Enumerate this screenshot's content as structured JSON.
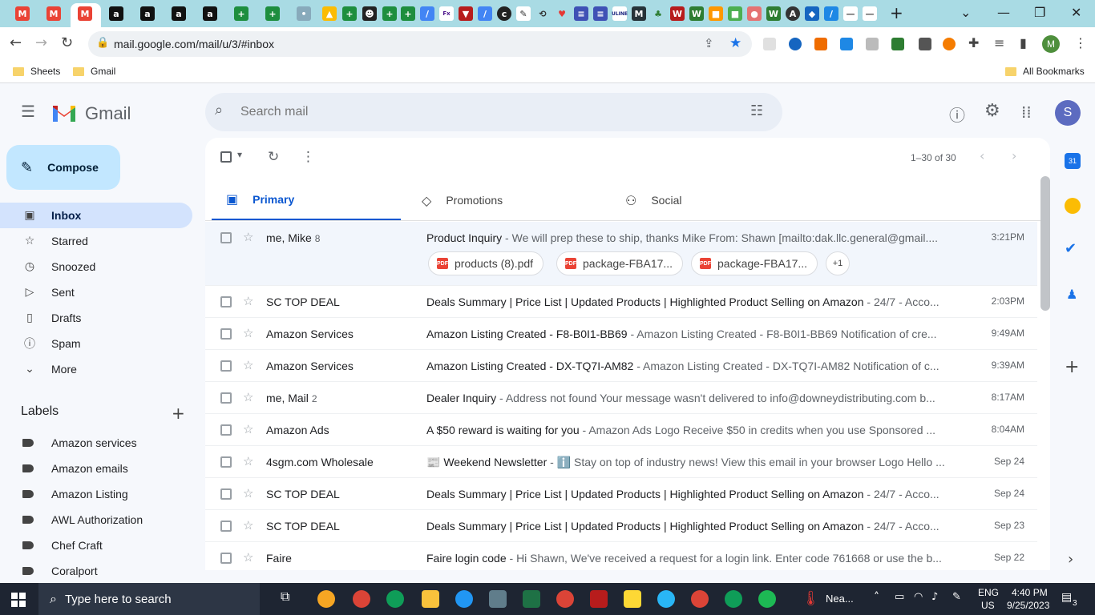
{
  "browser": {
    "url": "mail.google.com/mail/u/3/#inbox",
    "bookmarks": [
      "Sheets",
      "Gmail"
    ],
    "all_bookmarks": "All Bookmarks",
    "profile_initial": "M"
  },
  "gmail": {
    "brand": "Gmail",
    "search_placeholder": "Search mail",
    "avatar_initial": "S",
    "compose": "Compose"
  },
  "nav": [
    {
      "label": "Inbox",
      "icon": "inbox-icon",
      "active": true
    },
    {
      "label": "Starred",
      "icon": "star-icon"
    },
    {
      "label": "Snoozed",
      "icon": "clock-icon"
    },
    {
      "label": "Sent",
      "icon": "send-icon"
    },
    {
      "label": "Drafts",
      "icon": "draft-icon"
    },
    {
      "label": "Spam",
      "icon": "spam-icon"
    },
    {
      "label": "More",
      "icon": "chevron-down-icon"
    }
  ],
  "labels_header": "Labels",
  "labels": [
    "Amazon services",
    "Amazon emails",
    "Amazon Listing",
    "AWL Authorization",
    "Chef Craft",
    "Coralport"
  ],
  "toolbar": {
    "pagecount": "1–30 of 30"
  },
  "tabs": [
    {
      "label": "Primary",
      "icon": "inbox-icon"
    },
    {
      "label": "Promotions",
      "icon": "tag-icon"
    },
    {
      "label": "Social",
      "icon": "people-icon"
    }
  ],
  "attachments": [
    "products (8).pdf",
    "package-FBA17...",
    "package-FBA17...",
    "+1"
  ],
  "emails": [
    {
      "sender": "me, Mike",
      "count": "8",
      "subject": "Product Inquiry",
      "snippet": " - We will prep these to ship, thanks Mike From: Shawn [mailto:dak.llc.general@gmail....",
      "date": "3:21PM"
    },
    {
      "sender": "SC TOP DEAL",
      "count": "",
      "subject": "Deals Summary | Price List | Updated Products | Highlighted Product Selling on Amazon",
      "snippet": " - 24/7 - Acco...",
      "date": "2:03PM"
    },
    {
      "sender": "Amazon Services",
      "count": "",
      "subject": "Amazon Listing Created - F8-B0I1-BB69",
      "snippet": " - Amazon Listing Created - F8-B0I1-BB69 Notification of cre...",
      "date": "9:49AM"
    },
    {
      "sender": "Amazon Services",
      "count": "",
      "subject": "Amazon Listing Created - DX-TQ7I-AM82",
      "snippet": " - Amazon Listing Created - DX-TQ7I-AM82 Notification of c...",
      "date": "9:39AM"
    },
    {
      "sender": "me, Mail",
      "count": "2",
      "subject": "Dealer Inquiry",
      "snippet": " - Address not found Your message wasn't delivered to info@downeydistributing.com b...",
      "date": "8:17AM"
    },
    {
      "sender": "Amazon Ads",
      "count": "",
      "subject": "A $50 reward is waiting for you",
      "snippet": " - Amazon Ads Logo Receive $50 in credits when you use Sponsored ...",
      "date": "8:04AM"
    },
    {
      "sender": "4sgm.com Wholesale",
      "count": "",
      "subject": "📰 Weekend Newsletter",
      "snippet": " - ℹ️ Stay on top of industry news! View this email in your browser Logo Hello ...",
      "date": "Sep 24"
    },
    {
      "sender": "SC TOP DEAL",
      "count": "",
      "subject": "Deals Summary | Price List | Updated Products | Highlighted Product Selling on Amazon",
      "snippet": " - 24/7 - Acco...",
      "date": "Sep 24"
    },
    {
      "sender": "SC TOP DEAL",
      "count": "",
      "subject": "Deals Summary | Price List | Updated Products | Highlighted Product Selling on Amazon",
      "snippet": " - 24/7 - Acco...",
      "date": "Sep 23"
    },
    {
      "sender": "Faire",
      "count": "",
      "subject": "Faire login code",
      "snippet": " - Hi Shawn, We've received a request for a login link. Enter code 761668 or use the b...",
      "date": "Sep 22"
    }
  ],
  "taskbar": {
    "search": "Type here to search",
    "weather": "Nea...",
    "lang1": "ENG",
    "lang2": "US",
    "time": "4:40 PM",
    "date": "9/25/2023",
    "notif": "3"
  }
}
